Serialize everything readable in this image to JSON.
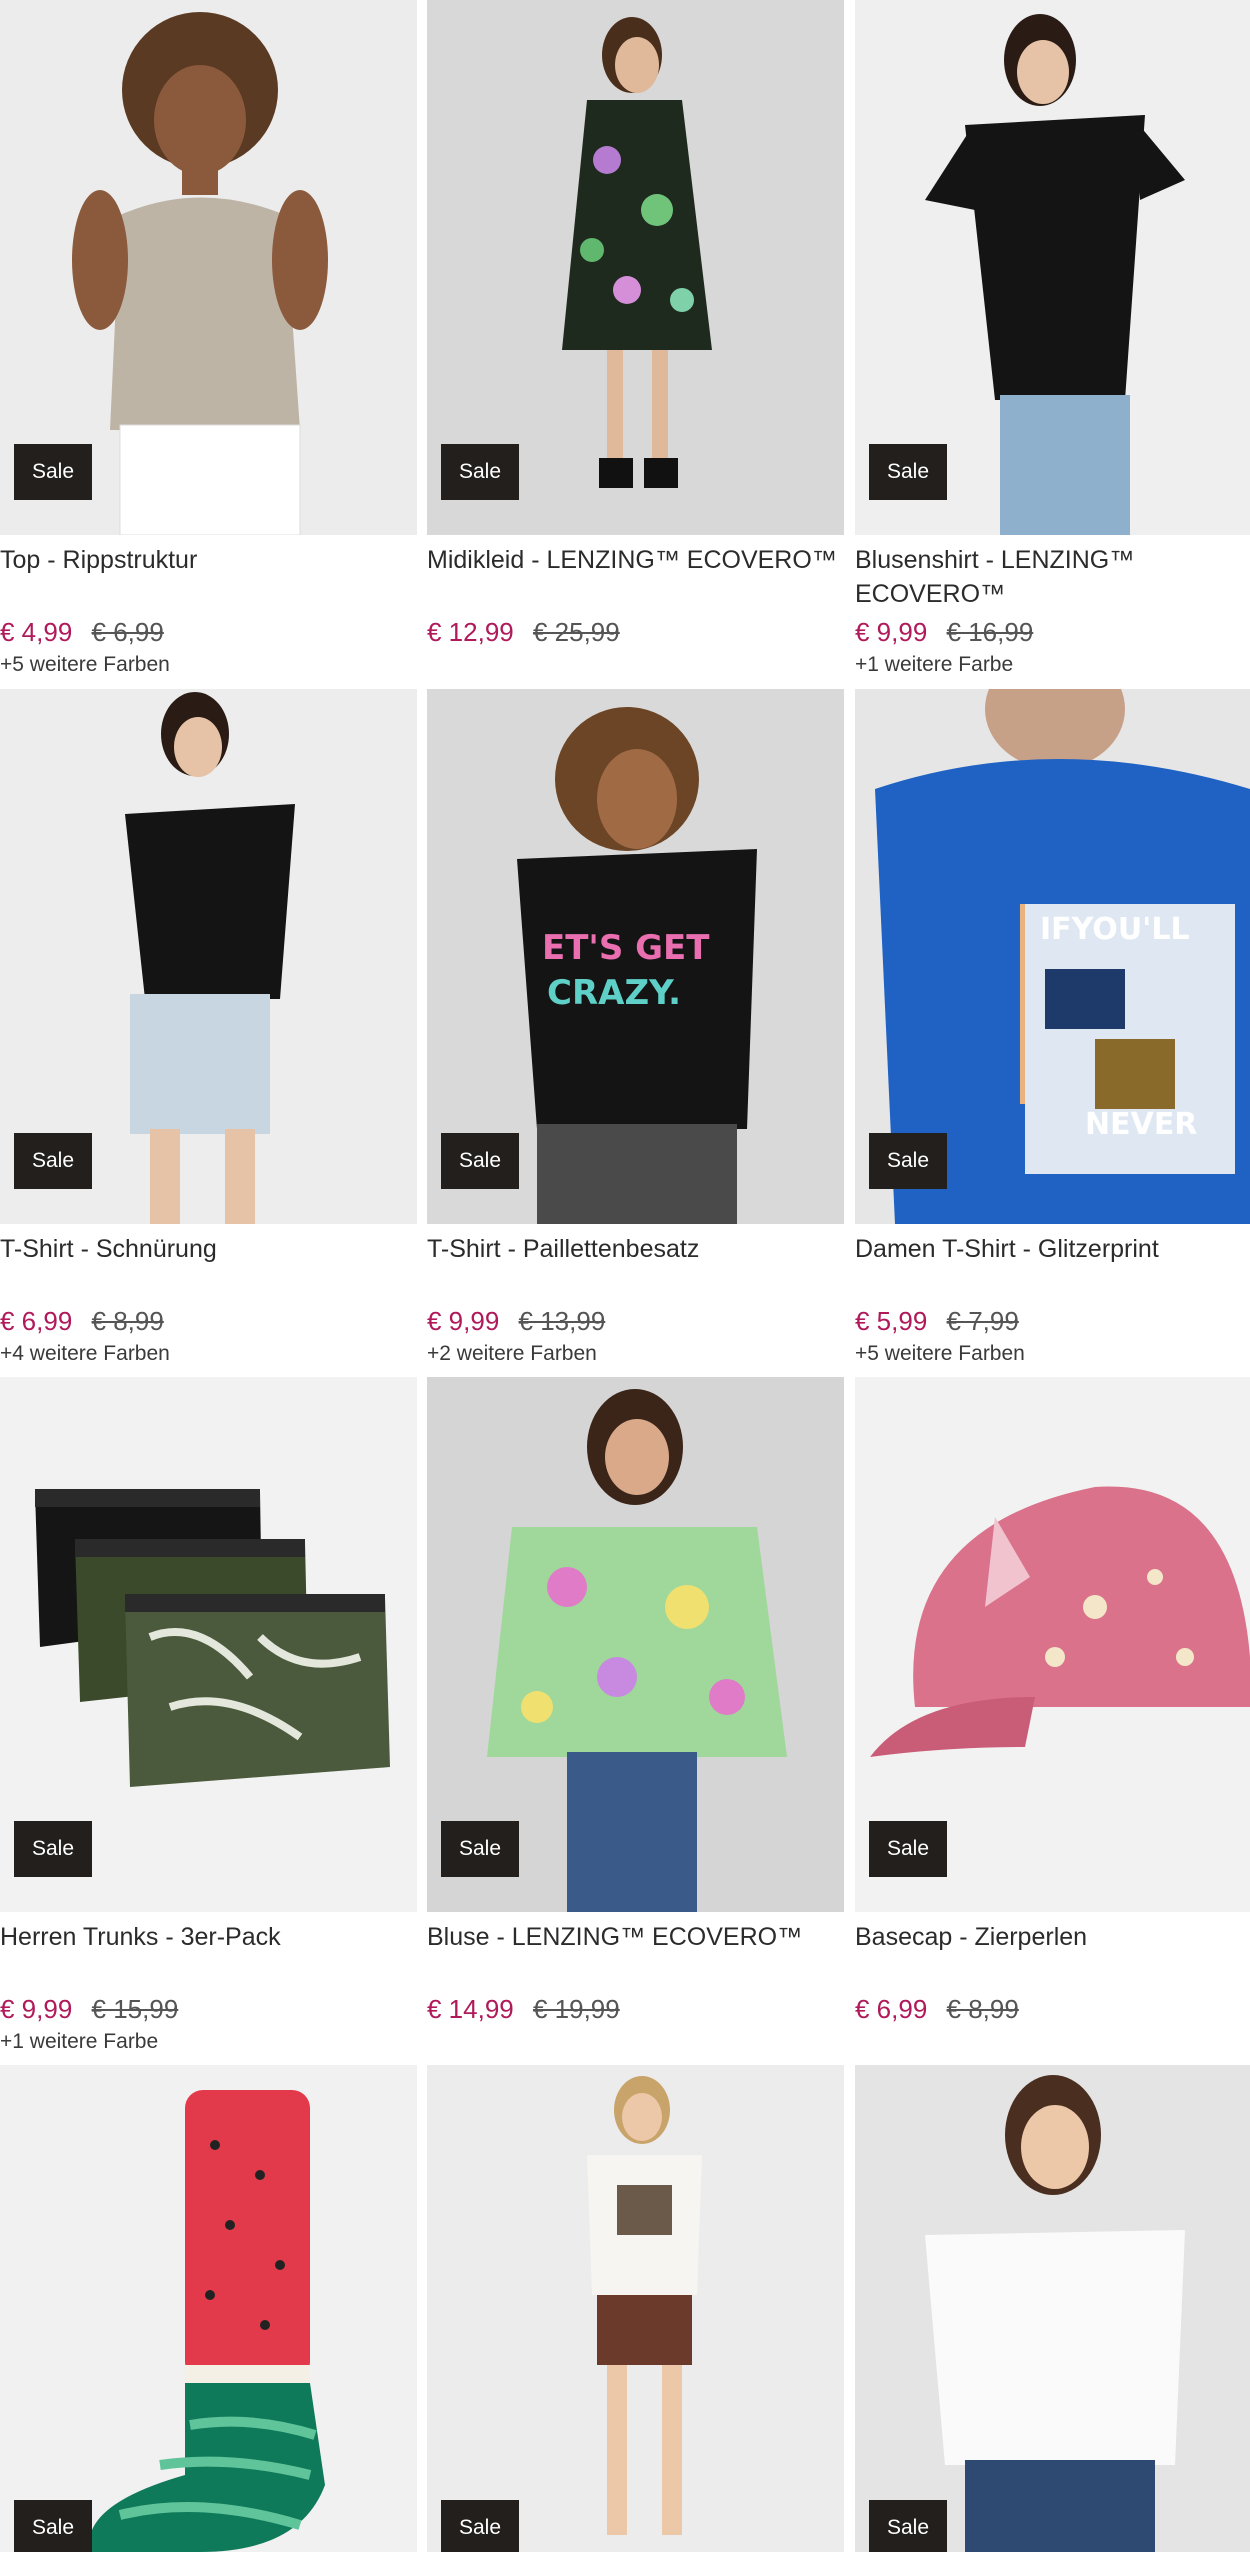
{
  "colors": {
    "price_sale": "#b01a5a",
    "price_old": "#555555",
    "badge_bg": "#231f1d",
    "badge_text": "#ffffff"
  },
  "products": [
    {
      "title": "Top - Rippstruktur",
      "badge": "Sale",
      "price": "€ 4,99",
      "old_price": "€ 6,99",
      "colors_note": "+5 weitere Farben",
      "image": "woman-beige-tank-top"
    },
    {
      "title": "Midikleid - LENZING™ ECOVERO™",
      "badge": "Sale",
      "price": "€ 12,99",
      "old_price": "€ 25,99",
      "colors_note": "",
      "image": "woman-floral-dress"
    },
    {
      "title": "Blusenshirt - LENZING™ ECOVERO™",
      "badge": "Sale",
      "price": "€ 9,99",
      "old_price": "€ 16,99",
      "colors_note": "+1 weitere Farbe",
      "image": "woman-black-ruffle-blouse"
    },
    {
      "title": "T-Shirt - Schnürung",
      "badge": "Sale",
      "price": "€ 6,99",
      "old_price": "€ 8,99",
      "colors_note": "+4 weitere Farben",
      "image": "woman-black-tshirt-shorts"
    },
    {
      "title": "T-Shirt - Paillettenbesatz",
      "badge": "Sale",
      "price": "€ 9,99",
      "old_price": "€ 13,99",
      "colors_note": "+2 weitere Farben",
      "image": "woman-black-sequin-tshirt"
    },
    {
      "title": "Damen T-Shirt - Glitzerprint",
      "badge": "Sale",
      "price": "€ 5,99",
      "old_price": "€ 7,99",
      "colors_note": "+5 weitere Farben",
      "image": "woman-blue-print-tshirt"
    },
    {
      "title": "Herren Trunks - 3er-Pack",
      "badge": "Sale",
      "price": "€ 9,99",
      "old_price": "€ 15,99",
      "colors_note": "+1 weitere Farbe",
      "image": "three-boxer-trunks"
    },
    {
      "title": "Bluse - LENZING™ ECOVERO™",
      "badge": "Sale",
      "price": "€ 14,99",
      "old_price": "€ 19,99",
      "colors_note": "",
      "image": "woman-floral-blouse"
    },
    {
      "title": "Basecap - Zierperlen",
      "badge": "Sale",
      "price": "€ 6,99",
      "old_price": "€ 8,99",
      "colors_note": "",
      "image": "pink-baseball-cap"
    },
    {
      "badge": "Sale",
      "image": "watermelon-sock"
    },
    {
      "badge": "Sale",
      "image": "woman-white-tshirt-brown-shorts"
    },
    {
      "badge": "Sale",
      "image": "woman-white-tshirt-jeans"
    }
  ]
}
